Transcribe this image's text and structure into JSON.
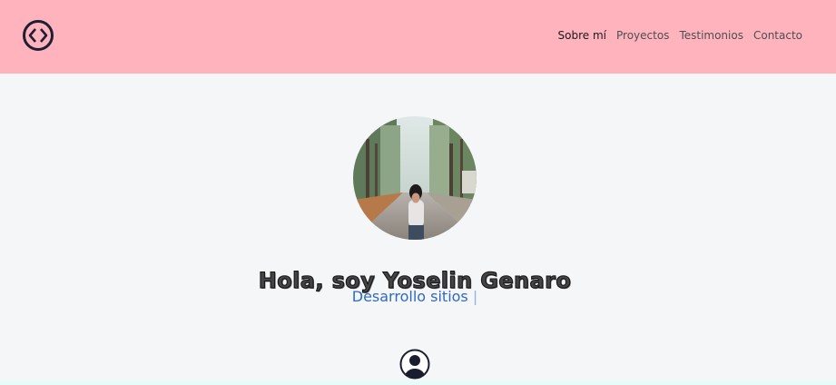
{
  "nav": {
    "logo_icon": "code-brackets-icon",
    "links": [
      {
        "label": "Sobre mí",
        "active": true
      },
      {
        "label": "Proyectos",
        "active": false
      },
      {
        "label": "Testimonios",
        "active": false
      },
      {
        "label": "Contacto",
        "active": false
      }
    ]
  },
  "hero": {
    "photo_icon": "profile-photo",
    "title": "Hola, soy Yoselin Genaro",
    "subtitle": "Desarrollo sitios",
    "cursor": "|",
    "profile_icon": "user-circle-icon"
  },
  "colors": {
    "navbar_bg": "#ffb3bd",
    "page_bg": "#f5f6f8",
    "accent": "#2f6ac2"
  }
}
